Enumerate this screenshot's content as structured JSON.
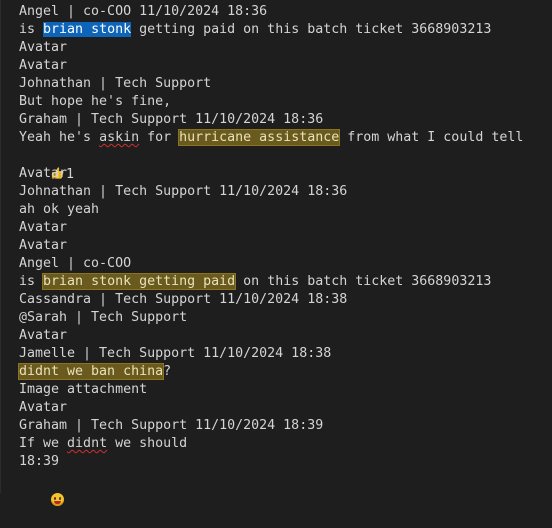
{
  "lines": [
    {
      "t": "Angel | co-COO 11/10/2024 18:36"
    },
    {
      "a": "is ",
      "sel": "brian stonk",
      "b": " getting paid on this batch ticket 3668903213"
    },
    {
      "t": "Avatar"
    },
    {
      "t": "Avatar"
    },
    {
      "t": "Johnathan | Tech Support"
    },
    {
      "t": "But hope he's fine,"
    },
    {
      "t": "Graham | Tech Support 11/10/2024 18:36"
    },
    {
      "a": "Yeah he's ",
      "sp": "askin",
      "b": " for ",
      "find": "hurricane assistance",
      "c": " from what I could tell"
    },
    {
      "count": "1"
    },
    {
      "t": "Avatar"
    },
    {
      "t": "Johnathan | Tech Support 11/10/2024 18:36"
    },
    {
      "t": "ah ok yeah"
    },
    {
      "t": "Avatar"
    },
    {
      "t": "Avatar"
    },
    {
      "t": "Angel | co-COO"
    },
    {
      "a": "is ",
      "find": "brian stonk getting paid",
      "b": " on this batch ticket 3668903213"
    },
    {
      "t": "Cassandra | Tech Support 11/10/2024 18:38"
    },
    {
      "t": "@Sarah | Tech Support"
    },
    {
      "t": "Avatar"
    },
    {
      "t": "Jamelle | Tech Support 11/10/2024 18:38"
    },
    {
      "find": "didnt we ban china",
      "b": "?"
    },
    {
      "t": "Image attachment"
    },
    {
      "t": "Avatar"
    },
    {
      "t": "Graham | Tech Support 11/10/2024 18:39"
    },
    {
      "a": "If we ",
      "sp": "didnt",
      "b": " we should"
    },
    {
      "t": "18:39"
    }
  ],
  "icons": {
    "thumbs": "thumbs-up-icon",
    "smile": "grinning-face-icon"
  },
  "colors": {
    "background": "#1e1e1e",
    "text": "#d4d4d4",
    "selection": "#0e64b8",
    "find_highlight": "#6a5a1e"
  }
}
